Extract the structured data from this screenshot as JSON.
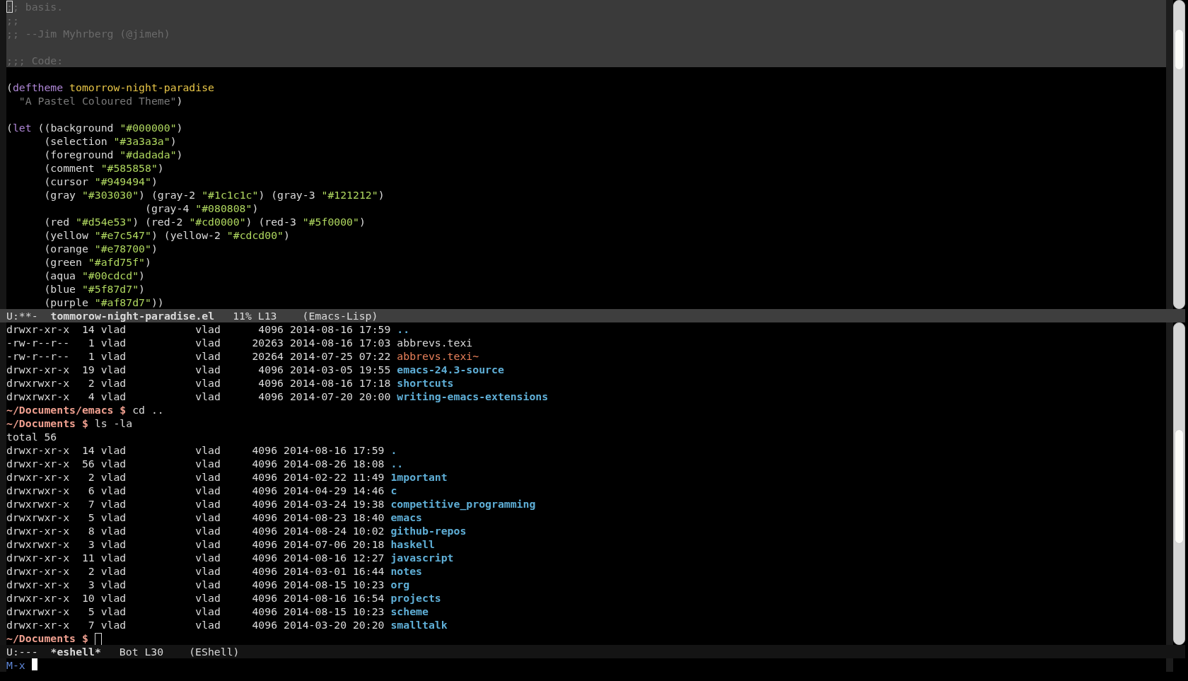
{
  "editor": {
    "lines": [
      {
        "highlighted": true,
        "segments": [
          {
            "kind": "cursor",
            "text": ";"
          },
          {
            "kind": "comment",
            "text": "; basis."
          }
        ]
      },
      {
        "highlighted": true,
        "segments": [
          {
            "kind": "comment",
            "text": ";;"
          }
        ]
      },
      {
        "highlighted": true,
        "segments": [
          {
            "kind": "comment",
            "text": ";; --Jim Myhrberg (@jimeh)"
          }
        ]
      },
      {
        "highlighted": true
      },
      {
        "highlighted": true,
        "segments": [
          {
            "kind": "comment",
            "text": ";;; Code:"
          }
        ]
      },
      {
        "highlighted": false
      },
      {
        "highlighted": false,
        "segments": [
          {
            "kind": "plain",
            "text": "("
          },
          {
            "kind": "keyword",
            "text": "deftheme "
          },
          {
            "kind": "name",
            "text": "tomorrow-night-paradise"
          }
        ]
      },
      {
        "highlighted": false,
        "segments": [
          {
            "kind": "doc",
            "text": "  \"A Pastel Coloured Theme\""
          },
          {
            "kind": "plain",
            "text": ")"
          }
        ]
      },
      {
        "highlighted": false
      },
      {
        "highlighted": false,
        "segments": [
          {
            "kind": "plain",
            "text": "("
          },
          {
            "kind": "keyword",
            "text": "let"
          },
          {
            "kind": "plain",
            "text": " ((background "
          },
          {
            "kind": "string",
            "text": "\"#000000\""
          },
          {
            "kind": "plain",
            "text": ")"
          }
        ]
      },
      {
        "highlighted": false,
        "segments": [
          {
            "kind": "plain",
            "text": "      (selection "
          },
          {
            "kind": "string",
            "text": "\"#3a3a3a\""
          },
          {
            "kind": "plain",
            "text": ")"
          }
        ]
      },
      {
        "highlighted": false,
        "segments": [
          {
            "kind": "plain",
            "text": "      (foreground "
          },
          {
            "kind": "string",
            "text": "\"#dadada\""
          },
          {
            "kind": "plain",
            "text": ")"
          }
        ]
      },
      {
        "highlighted": false,
        "segments": [
          {
            "kind": "plain",
            "text": "      (comment "
          },
          {
            "kind": "string",
            "text": "\"#585858\""
          },
          {
            "kind": "plain",
            "text": ")"
          }
        ]
      },
      {
        "highlighted": false,
        "segments": [
          {
            "kind": "plain",
            "text": "      (cursor "
          },
          {
            "kind": "string",
            "text": "\"#949494\""
          },
          {
            "kind": "plain",
            "text": ")"
          }
        ]
      },
      {
        "highlighted": false,
        "segments": [
          {
            "kind": "plain",
            "text": "      (gray "
          },
          {
            "kind": "string",
            "text": "\"#303030\""
          },
          {
            "kind": "plain",
            "text": ") (gray-2 "
          },
          {
            "kind": "string",
            "text": "\"#1c1c1c\""
          },
          {
            "kind": "plain",
            "text": ") (gray-3 "
          },
          {
            "kind": "string",
            "text": "\"#121212\""
          },
          {
            "kind": "plain",
            "text": ")"
          }
        ]
      },
      {
        "highlighted": false,
        "segments": [
          {
            "kind": "plain",
            "text": "                      (gray-4 "
          },
          {
            "kind": "string",
            "text": "\"#080808\""
          },
          {
            "kind": "plain",
            "text": ")"
          }
        ]
      },
      {
        "highlighted": false,
        "segments": [
          {
            "kind": "plain",
            "text": "      (red "
          },
          {
            "kind": "string",
            "text": "\"#d54e53\""
          },
          {
            "kind": "plain",
            "text": ") (red-2 "
          },
          {
            "kind": "string",
            "text": "\"#cd0000\""
          },
          {
            "kind": "plain",
            "text": ") (red-3 "
          },
          {
            "kind": "string",
            "text": "\"#5f0000\""
          },
          {
            "kind": "plain",
            "text": ")"
          }
        ]
      },
      {
        "highlighted": false,
        "segments": [
          {
            "kind": "plain",
            "text": "      (yellow "
          },
          {
            "kind": "string",
            "text": "\"#e7c547\""
          },
          {
            "kind": "plain",
            "text": ") (yellow-2 "
          },
          {
            "kind": "string",
            "text": "\"#cdcd00\""
          },
          {
            "kind": "plain",
            "text": ")"
          }
        ]
      },
      {
        "highlighted": false,
        "segments": [
          {
            "kind": "plain",
            "text": "      (orange "
          },
          {
            "kind": "string",
            "text": "\"#e78700\""
          },
          {
            "kind": "plain",
            "text": ")"
          }
        ]
      },
      {
        "highlighted": false,
        "segments": [
          {
            "kind": "plain",
            "text": "      (green "
          },
          {
            "kind": "string",
            "text": "\"#afd75f\""
          },
          {
            "kind": "plain",
            "text": ")"
          }
        ]
      },
      {
        "highlighted": false,
        "segments": [
          {
            "kind": "plain",
            "text": "      (aqua "
          },
          {
            "kind": "string",
            "text": "\"#00cdcd\""
          },
          {
            "kind": "plain",
            "text": ")"
          }
        ]
      },
      {
        "highlighted": false,
        "segments": [
          {
            "kind": "plain",
            "text": "      (blue "
          },
          {
            "kind": "string",
            "text": "\"#5f87d7\""
          },
          {
            "kind": "plain",
            "text": ")"
          }
        ]
      },
      {
        "highlighted": false,
        "segments": [
          {
            "kind": "plain",
            "text": "      (purple "
          },
          {
            "kind": "string",
            "text": "\"#af87d7\""
          },
          {
            "kind": "plain",
            "text": "))"
          }
        ]
      }
    ]
  },
  "editor_mode_line": {
    "active": true,
    "status": "U:**-",
    "buffer": "tommorow-night-paradise.el",
    "position": "11% L13",
    "mode": "(Emacs-Lisp)"
  },
  "eshell": {
    "lines": [
      {
        "kind": "listing",
        "info": "drwxr-xr-x  14 vlad           vlad      4096 2014-08-16 17:59",
        "name": "..",
        "color": "#5fafd7",
        "bold": true
      },
      {
        "kind": "listing",
        "info": "-rw-r--r--   1 vlad           vlad     20263 2014-08-16 17:03",
        "name": "abbrevs.texi",
        "color": "#dadada",
        "bold": false
      },
      {
        "kind": "listing",
        "info": "-rw-r--r--   1 vlad           vlad     20264 2014-07-25 07:22",
        "name": "abbrevs.texi~",
        "color": "#e8805a",
        "bold": false
      },
      {
        "kind": "listing",
        "info": "drwxr-xr-x  19 vlad           vlad      4096 2014-03-05 19:55",
        "name": "emacs-24.3-source",
        "color": "#5fafd7",
        "bold": true
      },
      {
        "kind": "listing",
        "info": "drwxrwxr-x   2 vlad           vlad      4096 2014-08-16 17:18",
        "name": "shortcuts",
        "color": "#5fafd7",
        "bold": true
      },
      {
        "kind": "listing",
        "info": "drwxrwxr-x   4 vlad           vlad      4096 2014-07-20 20:00",
        "name": "writing-emacs-extensions",
        "color": "#5fafd7",
        "bold": true
      },
      {
        "kind": "prompt",
        "path": "~/Documents/emacs $",
        "command": "cd .."
      },
      {
        "kind": "prompt",
        "path": "~/Documents $",
        "command": "ls -la"
      },
      {
        "kind": "text",
        "text": "total 56"
      },
      {
        "kind": "listing",
        "info": "drwxr-xr-x  14 vlad           vlad     4096 2014-08-16 17:59",
        "name": ".",
        "color": "#5fafd7",
        "bold": true
      },
      {
        "kind": "listing",
        "info": "drwxr-xr-x  56 vlad           vlad     4096 2014-08-26 18:08",
        "name": "..",
        "color": "#5fafd7",
        "bold": true
      },
      {
        "kind": "listing",
        "info": "drwxr-xr-x   2 vlad           vlad     4096 2014-02-22 11:49",
        "name": "1mportant",
        "color": "#5fafd7",
        "bold": true
      },
      {
        "kind": "listing",
        "info": "drwxrwxr-x   6 vlad           vlad     4096 2014-04-29 14:46",
        "name": "c",
        "color": "#5fafd7",
        "bold": true
      },
      {
        "kind": "listing",
        "info": "drwxrwxr-x   7 vlad           vlad     4096 2014-03-24 19:38",
        "name": "competitive_programming",
        "color": "#5fafd7",
        "bold": true
      },
      {
        "kind": "listing",
        "info": "drwxrwxr-x   5 vlad           vlad     4096 2014-08-23 18:40",
        "name": "emacs",
        "color": "#5fafd7",
        "bold": true
      },
      {
        "kind": "listing",
        "info": "drwxr-xr-x   8 vlad           vlad     4096 2014-08-24 10:02",
        "name": "github-repos",
        "color": "#5fafd7",
        "bold": true
      },
      {
        "kind": "listing",
        "info": "drwxrwxr-x   3 vlad           vlad     4096 2014-07-06 20:18",
        "name": "haskell",
        "color": "#5fafd7",
        "bold": true
      },
      {
        "kind": "listing",
        "info": "drwxr-xr-x  11 vlad           vlad     4096 2014-08-16 12:27",
        "name": "javascript",
        "color": "#5fafd7",
        "bold": true
      },
      {
        "kind": "listing",
        "info": "drwxr-xr-x   2 vlad           vlad     4096 2014-03-01 16:44",
        "name": "notes",
        "color": "#5fafd7",
        "bold": true
      },
      {
        "kind": "listing",
        "info": "drwxr-xr-x   3 vlad           vlad     4096 2014-08-15 10:23",
        "name": "org",
        "color": "#5fafd7",
        "bold": true
      },
      {
        "kind": "listing",
        "info": "drwxr-xr-x  10 vlad           vlad     4096 2014-08-16 16:54",
        "name": "projects",
        "color": "#5fafd7",
        "bold": true
      },
      {
        "kind": "listing",
        "info": "drwxrwxr-x   5 vlad           vlad     4096 2014-08-15 10:23",
        "name": "scheme",
        "color": "#5fafd7",
        "bold": true
      },
      {
        "kind": "listing",
        "info": "drwxr-xr-x   7 vlad           vlad     4096 2014-03-20 20:20",
        "name": "smalltalk",
        "color": "#5fafd7",
        "bold": true
      },
      {
        "kind": "prompt",
        "path": "~/Documents $",
        "cursor": true
      }
    ]
  },
  "eshell_mode_line": {
    "active": false,
    "status": "U:---",
    "buffer": "*eshell*",
    "position": "Bot L30",
    "mode": "(EShell)"
  },
  "minibuffer": {
    "prompt": "M-x"
  }
}
